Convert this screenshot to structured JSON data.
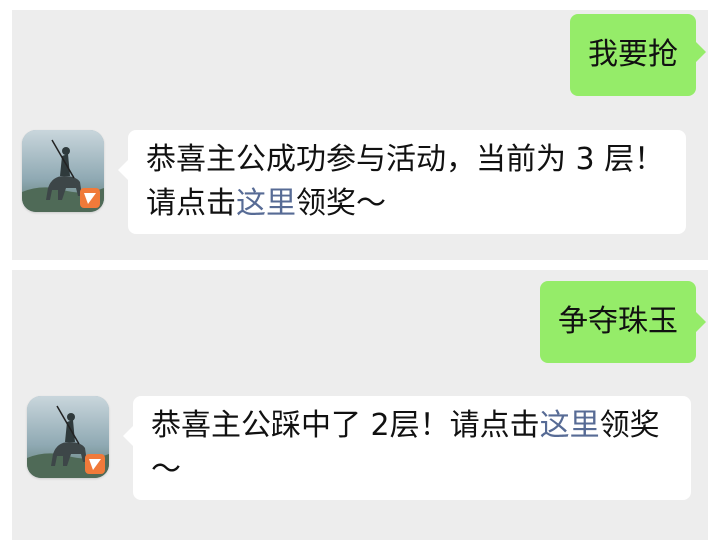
{
  "chat": [
    {
      "sent": {
        "text": "我要抢"
      },
      "received": {
        "avatar_icon": "game-character-avatar-icon",
        "text_before": "恭喜主公成功参与活动，当前为 3 层！请点击",
        "link_text": "这里",
        "text_after": "领奖～"
      }
    },
    {
      "sent": {
        "text": "争夺珠玉"
      },
      "received": {
        "avatar_icon": "game-character-avatar-icon",
        "text_before": "恭喜主公踩中了 2层！请点击",
        "link_text": "这里",
        "text_after": "领奖～"
      }
    }
  ],
  "colors": {
    "sent_bubble": "#95ec69",
    "received_bubble": "#ffffff",
    "link": "#576b95",
    "panel_bg": "#ededed"
  }
}
